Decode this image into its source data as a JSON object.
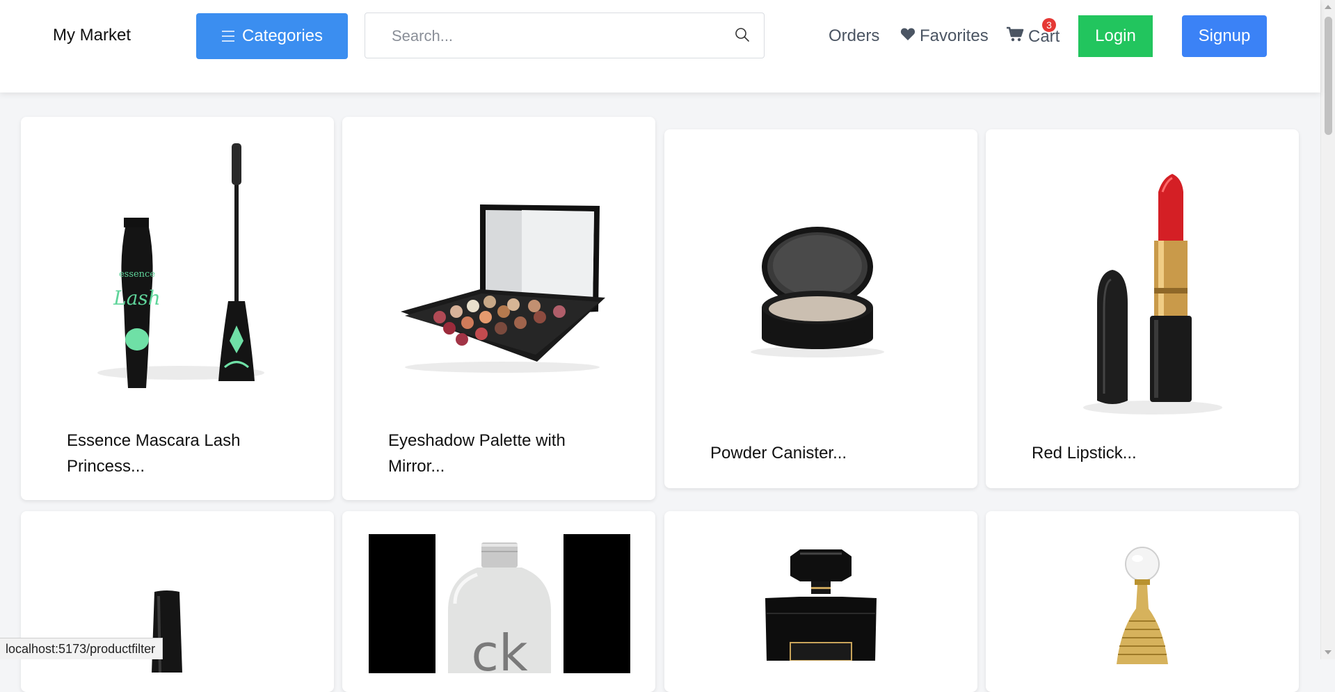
{
  "header": {
    "brand": "My Market",
    "categories_label": "Categories",
    "search_placeholder": "Search...",
    "search_value": "",
    "nav": {
      "orders": "Orders",
      "favorites": "Favorites",
      "cart": "Cart",
      "cart_count": "3"
    },
    "login_label": "Login",
    "signup_label": "Signup",
    "colors": {
      "categories_bg": "#3b8ef0",
      "login_bg": "#22c55e",
      "signup_bg": "#3b82f6",
      "badge_bg": "#e53935"
    }
  },
  "products": [
    {
      "title": "Essence Mascara Lash Princess...",
      "image": "mascara-image"
    },
    {
      "title": "Eyeshadow Palette with Mirror...",
      "image": "eyeshadow-palette-image"
    },
    {
      "title": "Powder Canister...",
      "image": "powder-canister-image"
    },
    {
      "title": "Red Lipstick...",
      "image": "red-lipstick-image"
    },
    {
      "title": "",
      "image": "nail-polish-image"
    },
    {
      "title": "",
      "image": "ck-perfume-image"
    },
    {
      "title": "",
      "image": "chanel-perfume-image"
    },
    {
      "title": "",
      "image": "dior-perfume-image"
    }
  ],
  "status_bar": {
    "url": "localhost:5173/productfilter"
  }
}
